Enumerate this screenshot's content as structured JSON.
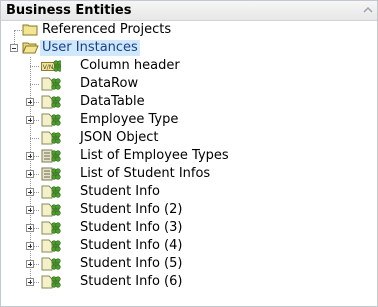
{
  "panel": {
    "title": "Business Entities"
  },
  "tree": {
    "referenced_projects": {
      "label": "Referenced Projects",
      "icon": "folder-closed-icon"
    },
    "user_instances": {
      "label": "User Instances",
      "icon": "folder-open-icon",
      "expanded": true,
      "selected": true,
      "children": [
        {
          "label": "Column header",
          "icon": "value-pair-icon",
          "expandable": false
        },
        {
          "label": "DataRow",
          "icon": "object-icon",
          "expandable": false
        },
        {
          "label": "DataTable",
          "icon": "object-icon",
          "expandable": true
        },
        {
          "label": "Employee Type",
          "icon": "object-icon",
          "expandable": true
        },
        {
          "label": "JSON Object",
          "icon": "object-icon",
          "expandable": false
        },
        {
          "label": "List of Employee Types",
          "icon": "list-icon",
          "expandable": true
        },
        {
          "label": "List of Student Infos",
          "icon": "list-icon",
          "expandable": true
        },
        {
          "label": "Student Info",
          "icon": "object-icon",
          "expandable": true
        },
        {
          "label": "Student Info (2)",
          "icon": "object-icon",
          "expandable": true
        },
        {
          "label": "Student Info (3)",
          "icon": "object-icon",
          "expandable": true
        },
        {
          "label": "Student Info (4)",
          "icon": "object-icon",
          "expandable": true
        },
        {
          "label": "Student Info (5)",
          "icon": "object-icon",
          "expandable": true
        },
        {
          "label": "Student Info (6)",
          "icon": "object-icon",
          "expandable": true
        }
      ]
    }
  },
  "colors": {
    "selection_bg": "#cfe8fb",
    "folder_yellow": "#e8d36a",
    "entity_green": "#4d9a2f"
  }
}
